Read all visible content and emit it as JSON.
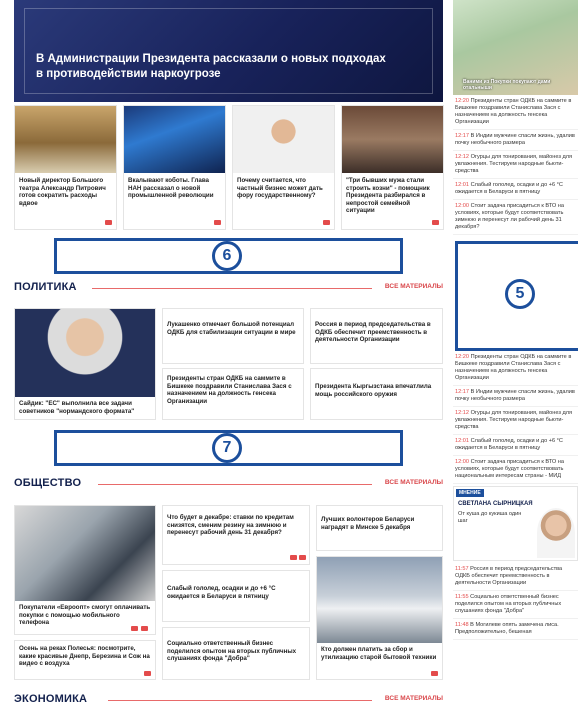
{
  "hero": {
    "title": "В Администрации Президента рассказали о новых подходах в противодействии наркоугрозе"
  },
  "thumbs": [
    {
      "caption": "Новый директор Большого театра Александр Питрович готов сократить расходы вдвое"
    },
    {
      "caption": "Вкалывают коботы. Глава НАН рассказал о новой промышленной революции"
    },
    {
      "caption": "Почему считается, что частный бизнес может дать фору государственному?"
    },
    {
      "caption": "\"Три бывших мужа стали строить козни\" - помощник Президента разбирался в непростой семейной ситуации"
    }
  ],
  "ads": {
    "six": "6",
    "seven": "7",
    "five": "5"
  },
  "sections": {
    "politics": {
      "title": "ПОЛИТИКА",
      "link": "ВСЕ МАТЕРИАЛЫ"
    },
    "society": {
      "title": "ОБЩЕСТВО",
      "link": "ВСЕ МАТЕРИАЛЫ"
    },
    "economy": {
      "title": "ЭКОНОМИКА",
      "link": "ВСЕ МАТЕРИАЛЫ"
    }
  },
  "politics": {
    "main_caption": "Сайдик: \"ЕС\" выполнила все задачи советников \"нормандского формата\"",
    "cards": [
      "Лукашенко отмечает большой потенциал ОДКБ для стабилизации ситуации в мире",
      "Россия в период председательства в ОДКБ обеспечит преемственность в деятельности Организации",
      "Президенты стран ОДКБ на саммите в Бишкеке поздравили Станислава Зася с назначением на должность генсека Организации",
      "Президента Кыргызстана впечатлила мощь российского оружия"
    ]
  },
  "society": {
    "main_caption": "Покупатели «Евроопт» смогут оплачивать покупки с помощью мобильного телефона",
    "extra_caption": "Осень на реках Полесья: посмотрите, какие красивые Днепр, Березина и Сож на видео с воздуха",
    "cards": [
      "Что будет в декабре: ставки по кредитам снизятся, сменим резину на зимнюю и перенесут рабочий день 31 декабря?",
      "Лучших волонтеров Беларуси наградят в Минске 5 декабря",
      "Слабый гололед, осадки и до +6 °С ожидается в Беларуси в пятницу",
      "Социально ответственный бизнес поделился опытом на вторых публичных слушаниях фонда \"Добра\""
    ],
    "photo_caption": "Кто должен платить за сбор и утилизацию старой бытовой техники"
  },
  "right": {
    "image_caption": "Ваними из Покупки покупают дами отальныши",
    "news_top": [
      {
        "time": "12:20",
        "text": "Президенты стран ОДКБ на саммите в Бишкеке поздравили Станислава Зася с назначением на должность генсека Организации"
      },
      {
        "time": "12:17",
        "text": "В Индии мужчине спасли жизнь, удалив почку необычного размера"
      },
      {
        "time": "12:12",
        "text": "Огурцы для тонирования, майонез для увлажнения. Тестируем народные бьюти-средства"
      },
      {
        "time": "12:01",
        "text": "Слабый гололед, осадки и до +6 °С ожидается в Беларуси в пятницу"
      },
      {
        "time": "12:00",
        "text": "Стоит задача присадиться к ВТО на условиях, которые будут соответствовать зимнюю и перенесут ли рабочий день 31 декабря?"
      }
    ],
    "news_bottom": [
      {
        "time": "12:20",
        "text": "Президенты стран ОДКБ на саммите в Бишкеке поздравили Станислава Зася с назначением на должность генсека Организации"
      },
      {
        "time": "12:17",
        "text": "В Индии мужчине спасли жизнь, удалив почку необычного размера"
      },
      {
        "time": "12:12",
        "text": "Огурцы для тонирования, майонез для увлажнения. Тестируем народные бьюти-средства"
      },
      {
        "time": "12:01",
        "text": "Слабый гололед, осадки и до +6 °С ожидается в Беларуси в пятницу"
      },
      {
        "time": "12:00",
        "text": "Стоит задача присадиться к ВТО на условиях, которые будут соответствовать национальным интересам страны - МИД"
      }
    ],
    "opinion": {
      "tag": "МНЕНИЕ",
      "name": "СВЕТЛАНА СЫРНИЦКАЯ",
      "text": "От куша до кукиша один шаг"
    },
    "news_tail": [
      {
        "time": "11:57",
        "text": "Россия в период председательства ОДКБ обеспечит преемственность в деятельности Организации"
      },
      {
        "time": "11:55",
        "text": "Социально ответственный бизнес поделился опытом на вторых публичных слушаниях фонда \"Добра\""
      },
      {
        "time": "11:48",
        "text": "В Могилеве опять замечена лиса. Предположительно, бешеная"
      }
    ]
  },
  "colors": {
    "brand_blue": "#1c4f9c",
    "accent_red": "#d9464a",
    "navy": "#13214d"
  }
}
